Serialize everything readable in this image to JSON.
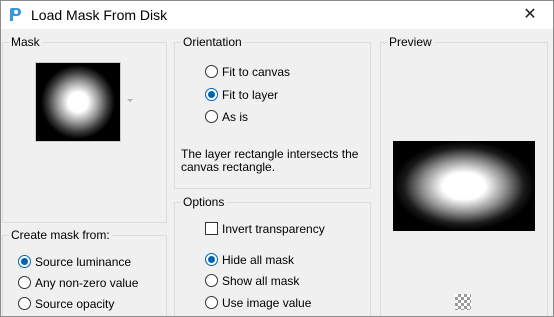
{
  "window": {
    "title": "Load Mask From Disk",
    "close_label": "✕"
  },
  "mask_group": {
    "label": "Mask"
  },
  "create_mask_group": {
    "label": "Create mask from:",
    "options": [
      {
        "label": "Source luminance",
        "selected": true
      },
      {
        "label": "Any non-zero value",
        "selected": false
      },
      {
        "label": "Source opacity",
        "selected": false
      }
    ]
  },
  "orientation_group": {
    "label": "Orientation",
    "options": [
      {
        "label": "Fit to canvas",
        "selected": false
      },
      {
        "label": "Fit to layer",
        "selected": true
      },
      {
        "label": "As is",
        "selected": false
      }
    ],
    "info_text": "The layer rectangle intersects the canvas rectangle."
  },
  "options_group": {
    "label": "Options",
    "invert_transparency": {
      "label": "Invert transparency",
      "checked": false
    },
    "mask_options": [
      {
        "label": "Hide all mask",
        "selected": true
      },
      {
        "label": "Show all mask",
        "selected": false
      },
      {
        "label": "Use image value",
        "selected": false
      }
    ]
  },
  "preview_group": {
    "label": "Preview"
  },
  "colors": {
    "accent": "#0063b1",
    "window_bg": "#f0f0f0",
    "titlebar_bg": "#ffffff"
  }
}
